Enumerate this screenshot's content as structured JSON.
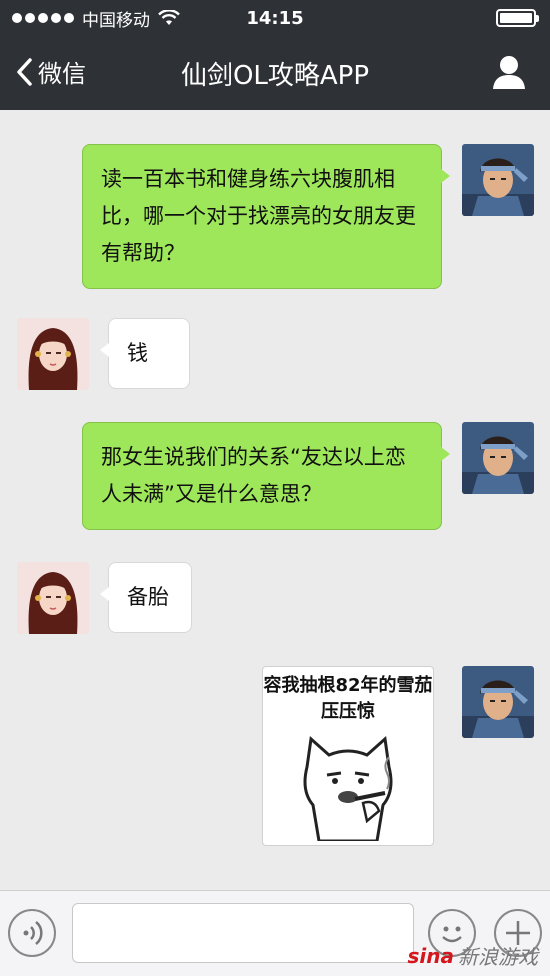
{
  "status_bar": {
    "carrier": "中国移动",
    "time": "14:15"
  },
  "nav": {
    "back_label": "微信",
    "title": "仙剑OL攻略APP"
  },
  "messages": [
    {
      "from": "me",
      "text": "读一百本书和健身练六块腹肌相比，哪一个对于找漂亮的女朋友更有帮助？"
    },
    {
      "from": "her",
      "text": "钱"
    },
    {
      "from": "me",
      "text": "那女生说我们的关系“友达以上恋人未满”又是什么意思？"
    },
    {
      "from": "her",
      "text": "备胎"
    },
    {
      "from": "me",
      "type": "sticker",
      "text": "容我抽根82年的雪茄压压惊"
    }
  ],
  "input": {
    "placeholder": ""
  },
  "watermark": {
    "logo": "sina",
    "text": "新浪游戏"
  },
  "colors": {
    "topbar": "#2e3136",
    "my_bubble": "#9ee65a",
    "her_bubble": "#ffffff",
    "background": "#ebebeb"
  }
}
